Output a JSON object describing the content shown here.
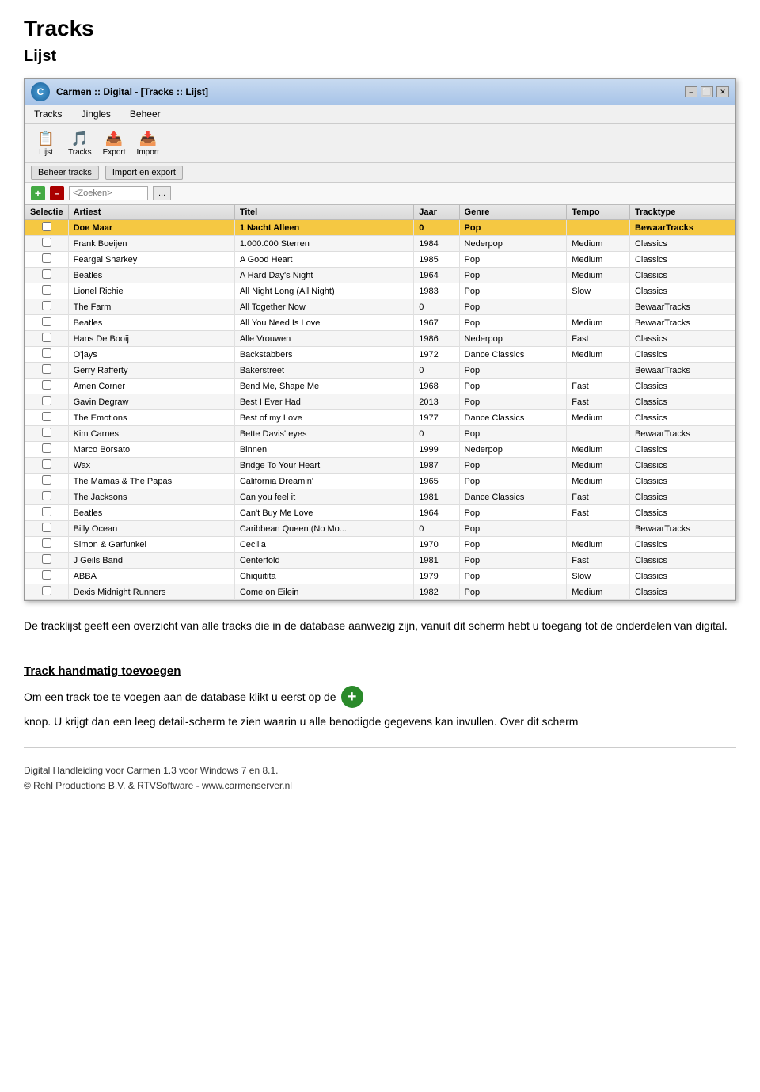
{
  "page": {
    "title": "Tracks",
    "subtitle": "Lijst"
  },
  "window": {
    "title": "Carmen :: Digital - [Tracks :: Lijst]",
    "controls": [
      "–",
      "⬜",
      "✕"
    ]
  },
  "menu": {
    "items": [
      "Tracks",
      "Jingles",
      "Beheer"
    ]
  },
  "toolbar": {
    "buttons": [
      {
        "label": "Lijst",
        "icon": "📋"
      },
      {
        "label": "Tracks",
        "icon": "🎵"
      },
      {
        "label": "Export",
        "icon": "📤"
      },
      {
        "label": "Import",
        "icon": "📥"
      }
    ]
  },
  "toolbar2": {
    "buttons": [
      "Beheer tracks",
      "Import en export"
    ]
  },
  "search": {
    "placeholder": "<Zoeken>",
    "options_label": "..."
  },
  "table": {
    "headers": [
      "Selectie",
      "Artiest",
      "Titel",
      "Jaar",
      "Genre",
      "Tempo",
      "Tracktype"
    ],
    "rows": [
      {
        "selectie": "",
        "artiest": "Doe Maar",
        "titel": "1 Nacht Alleen",
        "jaar": "0",
        "genre": "Pop",
        "tempo": "",
        "tracktype": "BewaarTracks",
        "highlight": true
      },
      {
        "selectie": "",
        "artiest": "Frank Boeijen",
        "titel": "1.000.000 Sterren",
        "jaar": "1984",
        "genre": "Nederpop",
        "tempo": "Medium",
        "tracktype": "Classics"
      },
      {
        "selectie": "",
        "artiest": "Feargal Sharkey",
        "titel": "A Good Heart",
        "jaar": "1985",
        "genre": "Pop",
        "tempo": "Medium",
        "tracktype": "Classics"
      },
      {
        "selectie": "",
        "artiest": "Beatles",
        "titel": "A Hard Day's Night",
        "jaar": "1964",
        "genre": "Pop",
        "tempo": "Medium",
        "tracktype": "Classics"
      },
      {
        "selectie": "",
        "artiest": "Lionel Richie",
        "titel": "All Night Long (All Night)",
        "jaar": "1983",
        "genre": "Pop",
        "tempo": "Slow",
        "tracktype": "Classics"
      },
      {
        "selectie": "",
        "artiest": "The Farm",
        "titel": "All Together Now",
        "jaar": "0",
        "genre": "Pop",
        "tempo": "",
        "tracktype": "BewaarTracks"
      },
      {
        "selectie": "",
        "artiest": "Beatles",
        "titel": "All You Need Is Love",
        "jaar": "1967",
        "genre": "Pop",
        "tempo": "Medium",
        "tracktype": "BewaarTracks"
      },
      {
        "selectie": "",
        "artiest": "Hans De Booij",
        "titel": "Alle Vrouwen",
        "jaar": "1986",
        "genre": "Nederpop",
        "tempo": "Fast",
        "tracktype": "Classics"
      },
      {
        "selectie": "",
        "artiest": "O'jays",
        "titel": "Backstabbers",
        "jaar": "1972",
        "genre": "Dance Classics",
        "tempo": "Medium",
        "tracktype": "Classics"
      },
      {
        "selectie": "",
        "artiest": "Gerry Rafferty",
        "titel": "Bakerstreet",
        "jaar": "0",
        "genre": "Pop",
        "tempo": "",
        "tracktype": "BewaarTracks"
      },
      {
        "selectie": "",
        "artiest": "Amen Corner",
        "titel": "Bend Me, Shape Me",
        "jaar": "1968",
        "genre": "Pop",
        "tempo": "Fast",
        "tracktype": "Classics"
      },
      {
        "selectie": "",
        "artiest": "Gavin Degraw",
        "titel": "Best I Ever Had",
        "jaar": "2013",
        "genre": "Pop",
        "tempo": "Fast",
        "tracktype": "Classics"
      },
      {
        "selectie": "",
        "artiest": "The Emotions",
        "titel": "Best of my Love",
        "jaar": "1977",
        "genre": "Dance Classics",
        "tempo": "Medium",
        "tracktype": "Classics"
      },
      {
        "selectie": "",
        "artiest": "Kim Carnes",
        "titel": "Bette Davis' eyes",
        "jaar": "0",
        "genre": "Pop",
        "tempo": "",
        "tracktype": "BewaarTracks"
      },
      {
        "selectie": "",
        "artiest": "Marco Borsato",
        "titel": "Binnen",
        "jaar": "1999",
        "genre": "Nederpop",
        "tempo": "Medium",
        "tracktype": "Classics"
      },
      {
        "selectie": "",
        "artiest": "Wax",
        "titel": "Bridge To Your Heart",
        "jaar": "1987",
        "genre": "Pop",
        "tempo": "Medium",
        "tracktype": "Classics"
      },
      {
        "selectie": "",
        "artiest": "The Mamas & The Papas",
        "titel": "California Dreamin'",
        "jaar": "1965",
        "genre": "Pop",
        "tempo": "Medium",
        "tracktype": "Classics"
      },
      {
        "selectie": "",
        "artiest": "The Jacksons",
        "titel": "Can you feel it",
        "jaar": "1981",
        "genre": "Dance Classics",
        "tempo": "Fast",
        "tracktype": "Classics"
      },
      {
        "selectie": "",
        "artiest": "Beatles",
        "titel": "Can't Buy Me Love",
        "jaar": "1964",
        "genre": "Pop",
        "tempo": "Fast",
        "tracktype": "Classics"
      },
      {
        "selectie": "",
        "artiest": "Billy Ocean",
        "titel": "Caribbean Queen (No Mo...",
        "jaar": "0",
        "genre": "Pop",
        "tempo": "",
        "tracktype": "BewaarTracks"
      },
      {
        "selectie": "",
        "artiest": "Simon & Garfunkel",
        "titel": "Cecilia",
        "jaar": "1970",
        "genre": "Pop",
        "tempo": "Medium",
        "tracktype": "Classics"
      },
      {
        "selectie": "",
        "artiest": "J Geils Band",
        "titel": "Centerfold",
        "jaar": "1981",
        "genre": "Pop",
        "tempo": "Fast",
        "tracktype": "Classics"
      },
      {
        "selectie": "",
        "artiest": "ABBA",
        "titel": "Chiquitita",
        "jaar": "1979",
        "genre": "Pop",
        "tempo": "Slow",
        "tracktype": "Classics"
      },
      {
        "selectie": "",
        "artiest": "Dexis Midnight Runners",
        "titel": "Come on Eilein",
        "jaar": "1982",
        "genre": "Pop",
        "tempo": "Medium",
        "tracktype": "Classics"
      }
    ]
  },
  "description": {
    "text": "De tracklijst geeft een overzicht van alle tracks die in de database aanwezig zijn, vanuit dit scherm hebt u toegang tot de onderdelen van digital.",
    "section_heading": "Track handmatig toevoegen",
    "section_text_before": "Om een track toe te voegen aan de database klikt u eerst op de",
    "section_text_after": "knop. U krijgt dan een leeg detail-scherm te zien waarin u alle benodigde gegevens kan invullen. Over dit scherm"
  },
  "footer": {
    "line1": "Digital Handleiding voor Carmen 1.3 voor Windows 7 en 8.1.",
    "line2": "© Rehl Productions B.V. & RTVSoftware - www.carmenserver.nl"
  }
}
